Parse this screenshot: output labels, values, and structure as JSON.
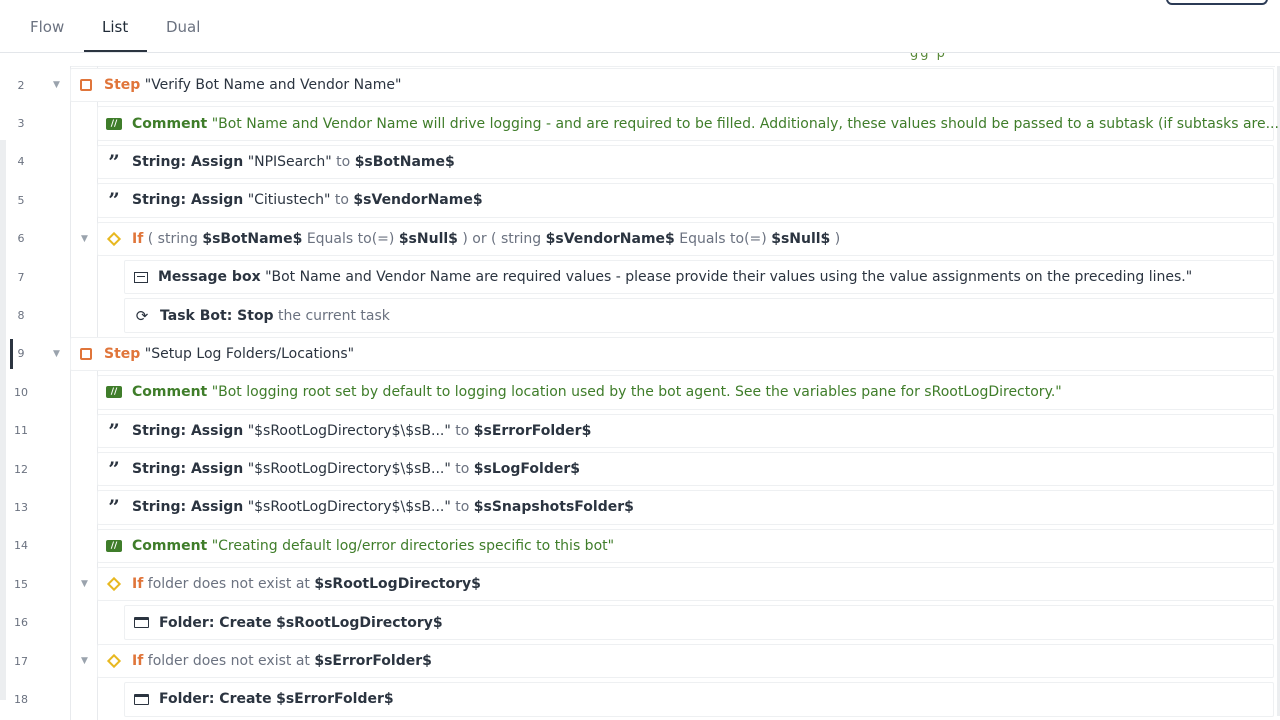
{
  "tabs": [
    {
      "label": "Flow"
    },
    {
      "label": "List",
      "active": true
    },
    {
      "label": "Dual"
    }
  ],
  "cut_off_text": "gg   p",
  "rows": [
    {
      "line": "2",
      "step_kw": "Step",
      "text": "\"Verify Bot Name and Vendor Name\""
    },
    {
      "line": "3",
      "comment_kw": "Comment",
      "text": "\"Bot Name and Vendor Name will drive logging - and are required to be filled. Additionaly, these values should be passed to a subtask (if subtasks are..."
    },
    {
      "line": "4",
      "action": "String: Assign",
      "value": "\"NPISearch\"",
      "to": "to",
      "var": "$sBotName$"
    },
    {
      "line": "5",
      "action": "String: Assign",
      "value": "\"Citiustech\"",
      "to": "to",
      "var": "$sVendorName$"
    },
    {
      "line": "6",
      "if_kw": "If",
      "p1": "( string",
      "v1": "$sBotName$",
      "p2": "Equals to(=)",
      "v2": "$sNull$",
      "p3": ") or ( string",
      "v3": "$sVendorName$",
      "p4": "Equals to(=)",
      "v4": "$sNull$",
      "p5": ")"
    },
    {
      "line": "7",
      "action": "Message box",
      "text": "\"Bot Name and Vendor Name are required values - please provide their values using the value assignments on the preceding lines.\""
    },
    {
      "line": "8",
      "action": "Task Bot: Stop",
      "text": "the current task"
    },
    {
      "line": "9",
      "step_kw": "Step",
      "text": "\"Setup Log Folders/Locations\""
    },
    {
      "line": "10",
      "comment_kw": "Comment",
      "text": "\"Bot logging root set by default to logging location used by the bot agent. See the variables pane for sRootLogDirectory.\""
    },
    {
      "line": "11",
      "action": "String: Assign",
      "value": "\"$sRootLogDirectory$\\$sB...\"",
      "to": "to",
      "var": "$sErrorFolder$"
    },
    {
      "line": "12",
      "action": "String: Assign",
      "value": "\"$sRootLogDirectory$\\$sB...\"",
      "to": "to",
      "var": "$sLogFolder$"
    },
    {
      "line": "13",
      "action": "String: Assign",
      "value": "\"$sRootLogDirectory$\\$sB...\"",
      "to": "to",
      "var": "$sSnapshotsFolder$"
    },
    {
      "line": "14",
      "comment_kw": "Comment",
      "text": "\"Creating default log/error directories specific to this bot\""
    },
    {
      "line": "15",
      "if_kw": "If",
      "cond": "folder does not exist at",
      "var": "$sRootLogDirectory$"
    },
    {
      "line": "16",
      "action": "Folder: Create",
      "var": "$sRootLogDirectory$"
    },
    {
      "line": "17",
      "if_kw": "If",
      "cond": "folder does not exist at",
      "var": "$sErrorFolder$"
    },
    {
      "line": "18",
      "action": "Folder: Create",
      "var": "$sErrorFolder$"
    }
  ],
  "icons": {
    "step": "step-checkbox-icon",
    "comment": "comment-icon",
    "string": "quote-icon",
    "if": "diamond-icon",
    "message": "message-box-icon",
    "stop": "stop-icon",
    "folder": "folder-icon"
  },
  "colors": {
    "step": "#e0753a",
    "comment": "#3f7d2a",
    "if_diamond": "#e8b820",
    "text": "#2b3440"
  }
}
